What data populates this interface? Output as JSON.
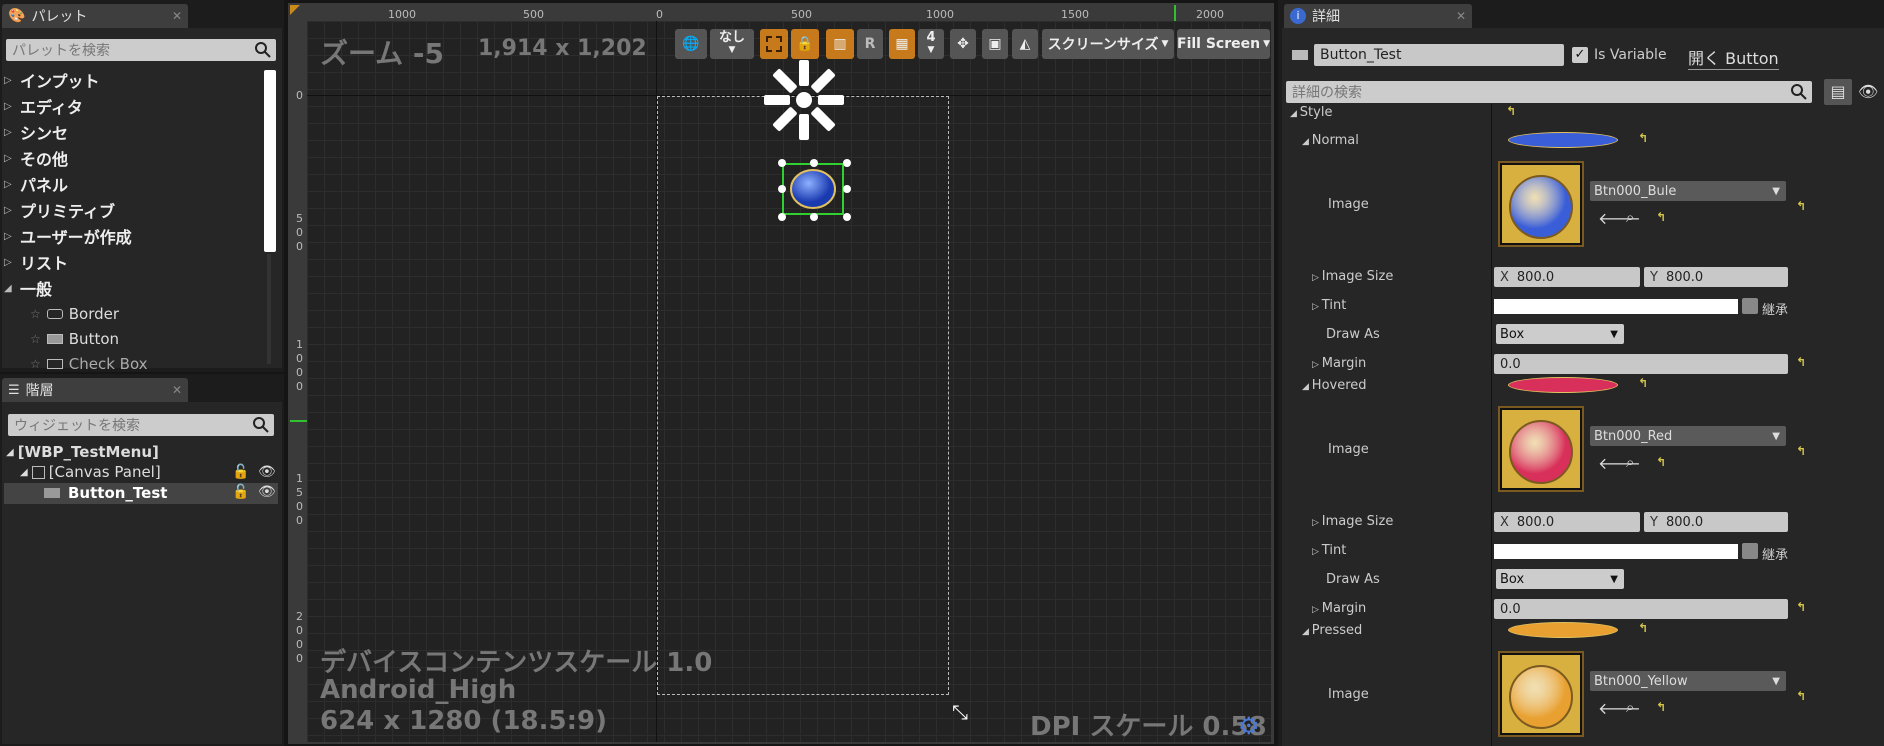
{
  "palette": {
    "tab": "パレット",
    "search_placeholder": "パレットを検索",
    "categories": [
      "インプット",
      "エディタ",
      "シンセ",
      "その他",
      "パネル",
      "プリミティブ",
      "ユーザーが作成",
      "リスト",
      "一般"
    ],
    "items": [
      "Border",
      "Button",
      "Check Box"
    ]
  },
  "hierarchy": {
    "tab": "階層",
    "search_placeholder": "ウィジェットを検索",
    "root": "[WBP_TestMenu]",
    "panel": "[Canvas Panel]",
    "child": "Button_Test"
  },
  "viewport": {
    "ruler_top": [
      "1000",
      "500",
      "0",
      "500",
      "1000",
      "1500",
      "2000"
    ],
    "ruler_left": [
      "0",
      "5\n0\n0",
      "1\n0\n0\n0",
      "1\n5\n0\n0",
      "2\n0\n0\n0"
    ],
    "zoom": "ズーム -5",
    "resolution": "1,914 x 1,202",
    "toolbar": {
      "none": "なし",
      "r": "R",
      "grid": "4",
      "screen_size": "スクリーンサイズ",
      "fill_screen": "Fill Screen"
    },
    "content_scale": "デバイスコンテンツスケール 1.0",
    "device": "Android_High",
    "device_res": "624 x 1280 (18.5:9)",
    "dpi": "DPI スケール 0.58"
  },
  "details": {
    "tab": "詳細",
    "name": "Button_Test",
    "is_variable": "Is Variable",
    "open": "開く Button",
    "search_placeholder": "詳細の検索",
    "style": "Style",
    "states": [
      {
        "name": "Normal",
        "image_label": "Image",
        "image": "Btn000_Bule",
        "size_label": "Image Size",
        "x": "800.0",
        "y": "800.0",
        "tint": "Tint",
        "inherit": "継承",
        "draw_as_label": "Draw As",
        "draw_as": "Box",
        "margin_label": "Margin",
        "margin": "0.0",
        "color": "#3a5ed8"
      },
      {
        "name": "Hovered",
        "image_label": "Image",
        "image": "Btn000_Red",
        "size_label": "Image Size",
        "x": "800.0",
        "y": "800.0",
        "tint": "Tint",
        "inherit": "継承",
        "draw_as_label": "Draw As",
        "draw_as": "Box",
        "margin_label": "Margin",
        "margin": "0.0",
        "color": "#d8305a"
      },
      {
        "name": "Pressed",
        "image_label": "Image",
        "image": "Btn000_Yellow",
        "color": "#e8a030"
      }
    ]
  }
}
